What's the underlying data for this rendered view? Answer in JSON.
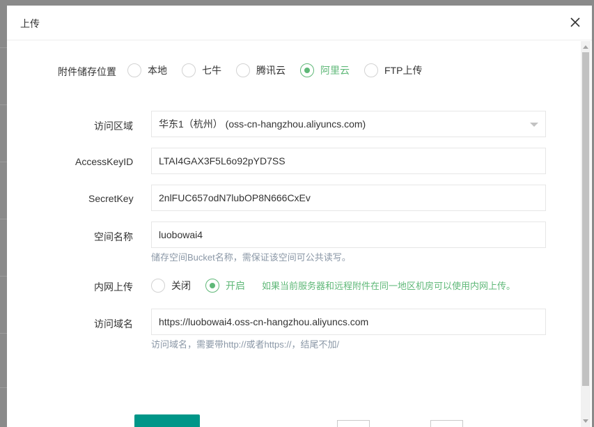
{
  "dialog": {
    "title": "上传",
    "storage_location": {
      "label": "附件储存位置",
      "options": [
        "本地",
        "七牛",
        "腾讯云",
        "阿里云",
        "FTP上传"
      ],
      "selected": "阿里云"
    },
    "region": {
      "label": "访问区域",
      "value": "华东1（杭州） (oss-cn-hangzhou.aliyuncs.com)"
    },
    "access_key_id": {
      "label": "AccessKeyID",
      "value": "LTAI4GAX3F5L6o92pYD7SS"
    },
    "secret_key": {
      "label": "SecretKey",
      "value": "2nlFUC657odN7lubOP8N666CxEv"
    },
    "bucket": {
      "label": "空间名称",
      "value": "luobowai4",
      "help": "储存空间Bucket名称，需保证该空间可公共读写。"
    },
    "intranet_upload": {
      "label": "内网上传",
      "options": [
        "关闭",
        "开启"
      ],
      "selected": "开启",
      "tip": "如果当前服务器和远程附件在同一地区机房可以使用内网上传。"
    },
    "domain": {
      "label": "访问域名",
      "value": "https://luobowai4.oss-cn-hangzhou.aliyuncs.com",
      "help": "访问域名，需要带http://或者https://，结尾不加/"
    }
  },
  "colors": {
    "accent": "#5fb878",
    "primary_button": "#009688",
    "help_text": "#8a97a6"
  }
}
